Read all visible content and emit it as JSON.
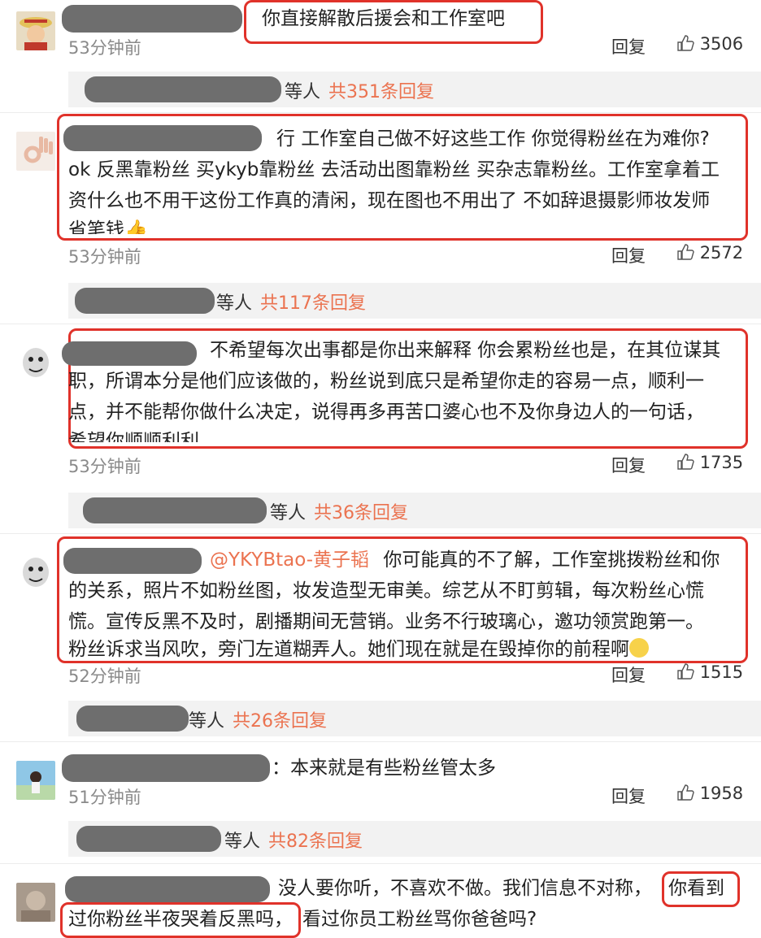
{
  "comments": [
    {
      "text": "你直接解散后援会和工作室吧",
      "time": "53分钟前",
      "reply": "回复",
      "likes": "3506",
      "thread": {
        "etc": "等人",
        "total": "共351条回复"
      }
    },
    {
      "line1": "行 工作室自己做不好这些工作 你觉得粉丝在为难你?",
      "line2": "ok 反黑靠粉丝 买ykyb靠粉丝 去活动出图靠粉丝 买杂志靠粉丝。工作室拿着工",
      "line3": "资什么也不用干这份工作真的清闲，现在图也不用出了 不如辞退摄影师妆发师",
      "line4": "省笔钱",
      "time": "53分钟前",
      "reply": "回复",
      "likes": "2572",
      "thread": {
        "etc": "等人",
        "total": "共117条回复"
      }
    },
    {
      "line1": "不希望每次出事都是你出来解释 你会累粉丝也是，在其位谋其",
      "line2": "职，所谓本分是他们应该做的，粉丝说到底只是希望你走的容易一点，顺利一",
      "line3": "点，并不能帮你做什么决定，说得再多再苦口婆心也不及你身边人的一句话，",
      "line4": "希望你顺顺利利。",
      "time": "53分钟前",
      "reply": "回复",
      "likes": "1735",
      "thread": {
        "etc": "等人",
        "total": "共36条回复"
      }
    },
    {
      "mention": "@YKYBtao-黄子韬",
      "line1": "你可能真的不了解，工作室挑拨粉丝和你",
      "line2": "的关系，照片不如粉丝图，妆发造型无审美。综艺从不盯剪辑，每次粉丝心慌",
      "line3": "慌。宣传反黑不及时，剧播期间无营销。业务不行玻璃心，邀功领赏跑第一。",
      "line4": "粉丝诉求当风吹，旁门左道糊弄人。她们现在就是在毁掉你的前程啊",
      "time": "52分钟前",
      "reply": "回复",
      "likes": "1515",
      "thread": {
        "etc": "等人",
        "total": "共26条回复"
      }
    },
    {
      "text": "：本来就是有些粉丝管太多",
      "time": "51分钟前",
      "reply": "回复",
      "likes": "1958",
      "thread": {
        "etc": "等人",
        "total": "共82条回复"
      }
    },
    {
      "line1a": "没人要你听，不喜欢不做。我们信息不对称，",
      "line1b": "你看到",
      "line2a": "过你粉丝半夜哭着反黑吗，",
      "line2b": "看过你员工粉丝骂你爸爸吗?"
    }
  ],
  "icons": {
    "like": "thumbs-up-icon",
    "emoji": "smile-emoji-icon"
  },
  "colors": {
    "highlight": "#e0322a",
    "accent": "#eb7350"
  }
}
